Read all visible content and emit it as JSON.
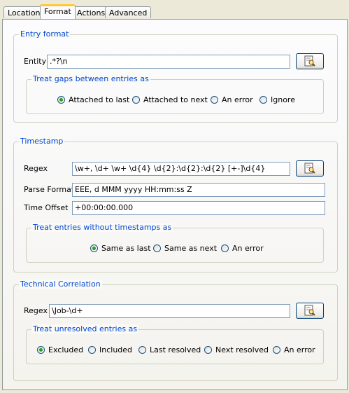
{
  "tabs": [
    {
      "label": "Location"
    },
    {
      "label": "Format"
    },
    {
      "label": "Actions"
    },
    {
      "label": "Advanced"
    }
  ],
  "entry_format": {
    "legend": "Entry format",
    "entity_label": "Entity",
    "entity_value": ".*?\\n",
    "gaps_legend": "Treat gaps between entries as",
    "gaps_options": [
      "Attached to last",
      "Attached to next",
      "An error",
      "Ignore"
    ],
    "gaps_selected": "Attached to last"
  },
  "timestamp": {
    "legend": "Timestamp",
    "regex_label": "Regex",
    "regex_value": "\\w+, \\d+ \\w+ \\d{4} \\d{2}:\\d{2}:\\d{2} [+-]\\d{4}",
    "parse_label": "Parse Format",
    "parse_value": "EEE, d MMM yyyy HH:mm:ss Z",
    "offset_label": "Time Offset",
    "offset_value": "+00:00:00.000",
    "without_legend": "Treat entries without timestamps as",
    "without_options": [
      "Same as last",
      "Same as next",
      "An error"
    ],
    "without_selected": "Same as last"
  },
  "correlation": {
    "legend": "Technical Correlation",
    "regex_label": "Regex",
    "regex_value": "\\Job-\\d+",
    "unresolved_legend": "Treat unresolved entries as",
    "unresolved_options": [
      "Excluded",
      "Included",
      "Last resolved",
      "Next resolved",
      "An error"
    ],
    "unresolved_selected": "Excluded"
  },
  "icons": {
    "test_button": "regex-test-icon"
  }
}
